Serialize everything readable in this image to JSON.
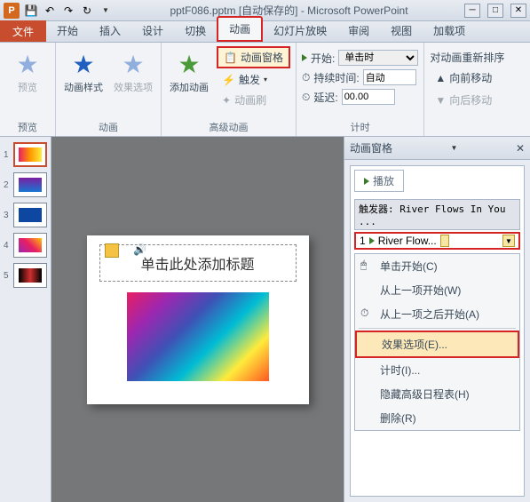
{
  "titlebar": {
    "app_letter": "P",
    "title": "pptF086.pptm [自动保存的] - Microsoft PowerPoint"
  },
  "tabs": {
    "file": "文件",
    "items": [
      "开始",
      "插入",
      "设计",
      "切换",
      "动画",
      "幻灯片放映",
      "审阅",
      "视图",
      "加载项"
    ],
    "active_index": 4
  },
  "ribbon": {
    "preview": {
      "label": "预览",
      "group": "预览"
    },
    "anim": {
      "style": "动画样式",
      "options": "效果选项",
      "group": "动画"
    },
    "adv": {
      "add": "添加动画",
      "pane": "动画窗格",
      "trigger": "触发",
      "painter": "动画刷",
      "group": "高级动画"
    },
    "timing": {
      "start_label": "开始:",
      "start_value": "单击时",
      "duration_label": "持续时间:",
      "duration_value": "自动",
      "delay_label": "延迟:",
      "delay_value": "00.00",
      "group": "计时"
    },
    "reorder": {
      "title": "对动画重新排序",
      "up": "向前移动",
      "down": "向后移动"
    }
  },
  "thumbs": [
    {
      "num": "1",
      "cls": "grad1"
    },
    {
      "num": "2",
      "cls": "grad2"
    },
    {
      "num": "3",
      "cls": "grad3"
    },
    {
      "num": "4",
      "cls": "grad4"
    },
    {
      "num": "5",
      "cls": "grad5"
    }
  ],
  "slide": {
    "title_placeholder": "单击此处添加标题"
  },
  "pane": {
    "title": "动画窗格",
    "play": "播放",
    "trigger_line": "触发器: River Flows In You ...",
    "item_num": "1",
    "item_label": "River Flow...",
    "menu": {
      "click_start": "单击开始(C)",
      "with_prev": "从上一项开始(W)",
      "after_prev": "从上一项之后开始(A)",
      "effect_opts": "效果选项(E)...",
      "timing": "计时(I)...",
      "hide_adv": "隐藏高级日程表(H)",
      "delete": "删除(R)"
    }
  }
}
